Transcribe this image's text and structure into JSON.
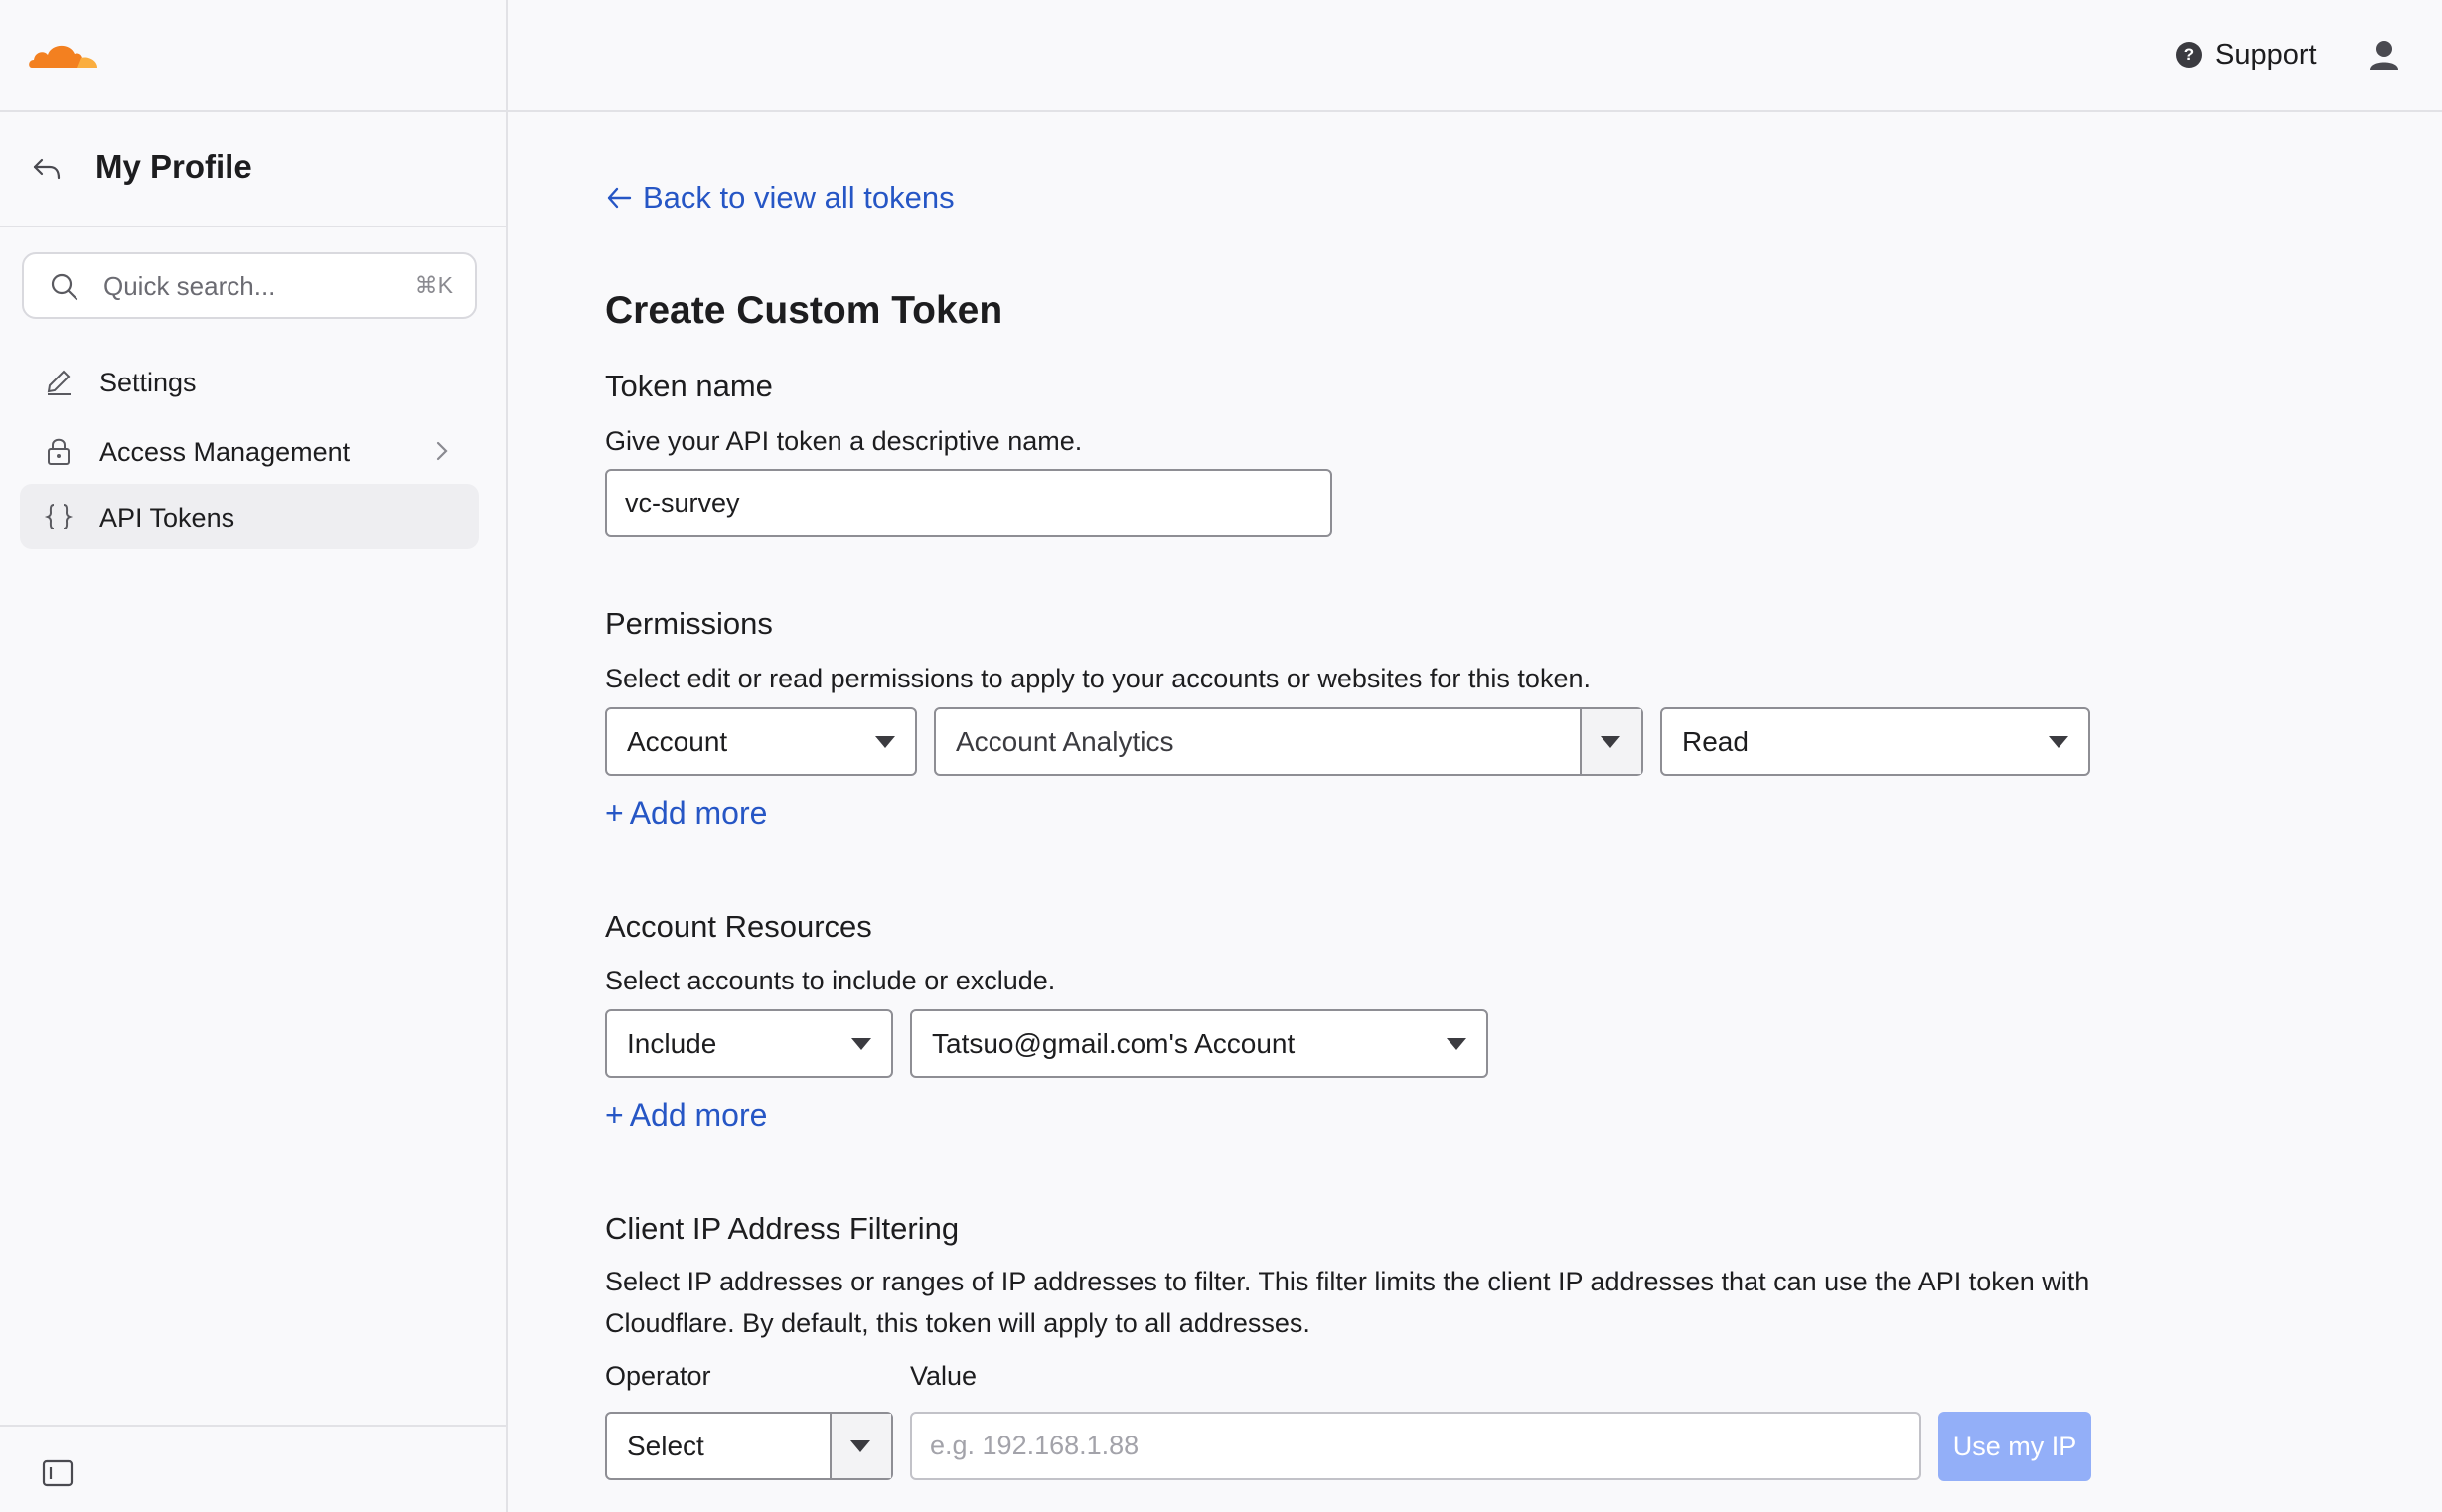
{
  "topbar": {
    "support_label": "Support",
    "accent": "#f38020"
  },
  "sidebar": {
    "title": "My Profile",
    "search": {
      "placeholder": "Quick search...",
      "shortcut": "⌘K"
    },
    "items": [
      {
        "label": "Settings",
        "icon": "pencil-icon",
        "active": false
      },
      {
        "label": "Access Management",
        "icon": "lock-icon",
        "active": false,
        "has_chevron": true
      },
      {
        "label": "API Tokens",
        "icon": "braces-icon",
        "active": true
      }
    ]
  },
  "main": {
    "back_link": "Back to view all tokens",
    "page_title": "Create Custom Token",
    "token_name": {
      "heading": "Token name",
      "description": "Give your API token a descriptive name.",
      "value": "vc-survey"
    },
    "permissions": {
      "heading": "Permissions",
      "description": "Select edit or read permissions to apply to your accounts or websites for this token.",
      "scope": "Account",
      "permission": "Account Analytics",
      "access": "Read",
      "add_more": "Add more"
    },
    "account_resources": {
      "heading": "Account Resources",
      "description": "Select accounts to include or exclude.",
      "mode": "Include",
      "account": "Tatsuo@gmail.com's Account",
      "add_more": "Add more"
    },
    "ip_filtering": {
      "heading": "Client IP Address Filtering",
      "description": "Select IP addresses or ranges of IP addresses to filter. This filter limits the client IP addresses that can use the API token with Cloudflare. By default, this token will apply to all addresses.",
      "operator_label": "Operator",
      "value_label": "Value",
      "operator_value": "Select",
      "value_placeholder": "e.g. 192.168.1.88",
      "use_ip_button": "Use my IP"
    }
  }
}
